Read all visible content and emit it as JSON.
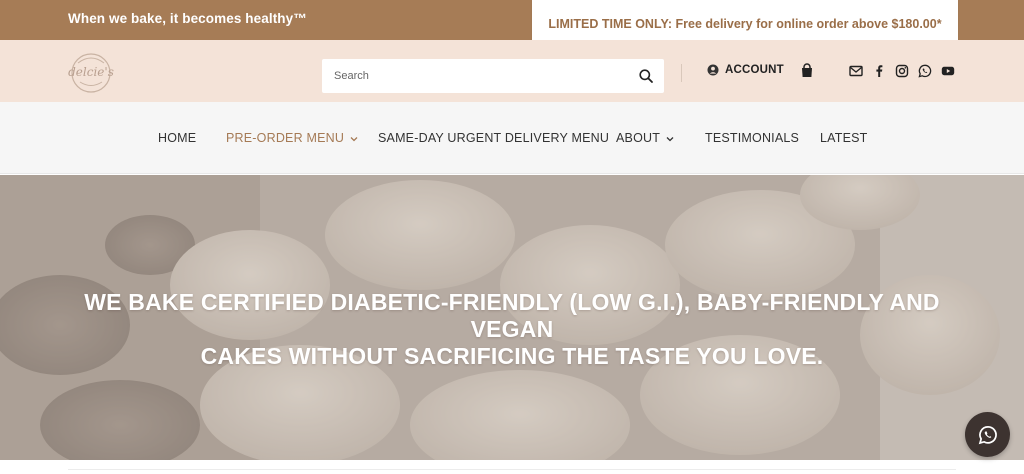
{
  "topbar": {
    "tagline": "When we bake, it becomes healthy™",
    "promo": "LIMITED TIME ONLY: Free delivery for online order above $180.00*"
  },
  "header": {
    "logo_text": "delcie's",
    "search_placeholder": "Search",
    "account_label": "ACCOUNT",
    "social_icons": [
      "mail-icon",
      "facebook-icon",
      "instagram-icon",
      "whatsapp-icon",
      "youtube-icon"
    ]
  },
  "nav": {
    "items": [
      {
        "label": "HOME",
        "dropdown": false,
        "active": false
      },
      {
        "label": "PRE-ORDER MENU",
        "dropdown": true,
        "active": true
      },
      {
        "label": "SAME-DAY URGENT DELIVERY MENU",
        "dropdown": false,
        "active": false
      },
      {
        "label": "ABOUT",
        "dropdown": true,
        "active": false
      },
      {
        "label": "TESTIMONIALS",
        "dropdown": false,
        "active": false
      },
      {
        "label": "LATEST",
        "dropdown": false,
        "active": false
      }
    ]
  },
  "hero": {
    "headline_line1": "WE BAKE CERTIFIED DIABETIC-FRIENDLY (LOW G.I.), BABY-FRIENDLY AND VEGAN",
    "headline_line2": "CAKES WITHOUT SACRIFICING THE TASTE YOU LOVE."
  },
  "floating": {
    "chat_icon": "whatsapp-icon"
  },
  "colors": {
    "topbar_bg": "#a67c56",
    "header_bg": "#f4e3d8",
    "accent_text": "#a57a55",
    "nav_bg": "#f6f6f6",
    "float_button_bg": "#3d3330"
  }
}
